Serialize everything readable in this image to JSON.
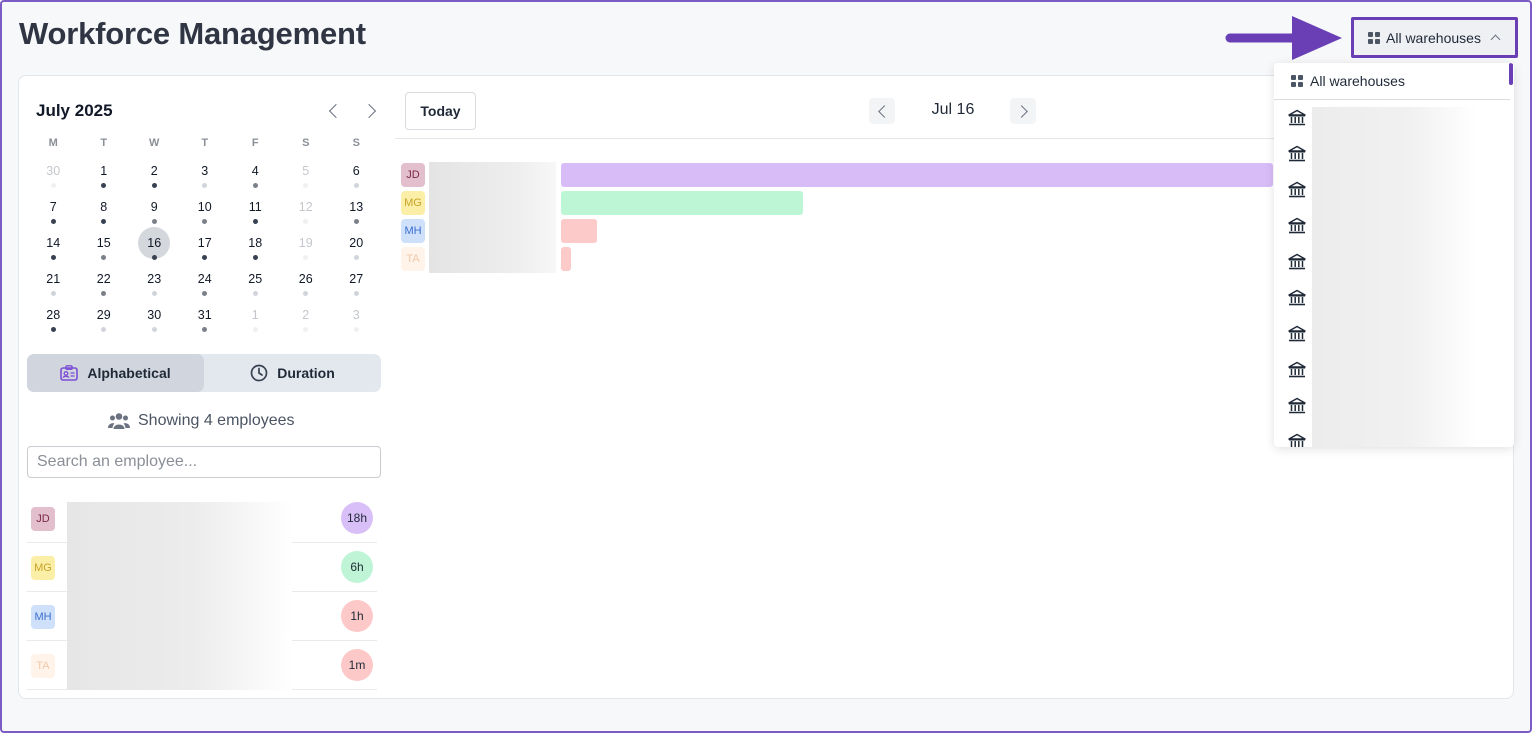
{
  "page": {
    "title": "Workforce Management"
  },
  "warehouse_selector": {
    "label": "All warehouses",
    "icon": "grid-icon"
  },
  "dropdown": {
    "all_label": "All warehouses",
    "warehouse_icon": "warehouse-icon",
    "item_count_visible": 10
  },
  "calendar": {
    "month_label": "July 2025",
    "weekdays": [
      "M",
      "T",
      "W",
      "T",
      "F",
      "S",
      "S"
    ],
    "weeks": [
      [
        {
          "d": "30",
          "m": true,
          "dot": "faint"
        },
        {
          "d": "1",
          "dot": "dark"
        },
        {
          "d": "2",
          "dot": "dark"
        },
        {
          "d": "3",
          "dot": "light"
        },
        {
          "d": "4",
          "dot": "mid"
        },
        {
          "d": "5",
          "m": true,
          "dot": "faint"
        },
        {
          "d": "6",
          "dot": "light"
        }
      ],
      [
        {
          "d": "7",
          "dot": "dark"
        },
        {
          "d": "8",
          "dot": "dark"
        },
        {
          "d": "9",
          "dot": "mid"
        },
        {
          "d": "10",
          "dot": "mid"
        },
        {
          "d": "11",
          "dot": "dark"
        },
        {
          "d": "12",
          "m": true,
          "dot": "faint"
        },
        {
          "d": "13",
          "dot": "mid"
        }
      ],
      [
        {
          "d": "14",
          "dot": "dark"
        },
        {
          "d": "15",
          "dot": "mid"
        },
        {
          "d": "16",
          "dot": "dark",
          "sel": true
        },
        {
          "d": "17",
          "dot": "dark"
        },
        {
          "d": "18",
          "dot": "dark"
        },
        {
          "d": "19",
          "m": true,
          "dot": "faint"
        },
        {
          "d": "20",
          "dot": "light"
        }
      ],
      [
        {
          "d": "21",
          "dot": "light"
        },
        {
          "d": "22",
          "dot": "mid"
        },
        {
          "d": "23",
          "dot": "light"
        },
        {
          "d": "24",
          "dot": "mid"
        },
        {
          "d": "25",
          "dot": "light"
        },
        {
          "d": "26",
          "dot": "light"
        },
        {
          "d": "27",
          "dot": "light"
        }
      ],
      [
        {
          "d": "28",
          "dot": "dark"
        },
        {
          "d": "29",
          "dot": "light"
        },
        {
          "d": "30",
          "dot": "light"
        },
        {
          "d": "31",
          "dot": "mid"
        },
        {
          "d": "1",
          "m": true,
          "dot": "faint"
        },
        {
          "d": "2",
          "m": true,
          "dot": "faint"
        },
        {
          "d": "3",
          "m": true,
          "dot": "faint"
        }
      ]
    ],
    "selected_day": "16"
  },
  "sort": {
    "alphabetical_label": "Alphabetical",
    "duration_label": "Duration",
    "active": "alphabetical"
  },
  "employees_summary": "Showing 4 employees",
  "search": {
    "placeholder": "Search an employee...",
    "value": ""
  },
  "employees": [
    {
      "initials": "JD",
      "duration": "18h",
      "badge_bg": "#e3bfcd",
      "badge_fg": "#7a2a44",
      "dur_bg": "#d9bff7",
      "bar_color": "#d8bcf8",
      "bar_fraction": 1.0
    },
    {
      "initials": "MG",
      "duration": "6h",
      "badge_bg": "#fbefa7",
      "badge_fg": "#c9a227",
      "dur_bg": "#bff5d6",
      "bar_color": "#bdf6d4",
      "bar_fraction": 0.34
    },
    {
      "initials": "MH",
      "duration": "1h",
      "badge_bg": "#cfe0fb",
      "badge_fg": "#3b6fd1",
      "dur_bg": "#fcc8c8",
      "bar_color": "#fdcaca",
      "bar_fraction": 0.05
    },
    {
      "initials": "TA",
      "duration": "1m",
      "badge_bg": "#fff3ea",
      "badge_fg": "#f2c9a8",
      "dur_bg": "#fcc8c8",
      "bar_color": "#fdcaca",
      "bar_fraction": 0.014
    }
  ],
  "timeline": {
    "today_label": "Today",
    "date_label": "Jul 16"
  },
  "colors": {
    "accent": "#6a3fb5",
    "arrow": "#6a3fb5"
  }
}
